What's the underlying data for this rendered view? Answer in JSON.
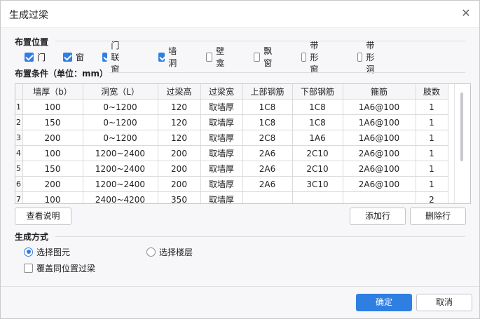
{
  "dialog": {
    "title": "生成过梁",
    "close_glyph": "✕"
  },
  "placement": {
    "label": "布置位置",
    "options": [
      {
        "label": "门",
        "checked": true
      },
      {
        "label": "窗",
        "checked": true
      },
      {
        "label": "门联窗",
        "checked": true
      },
      {
        "label": "墙洞",
        "checked": true
      },
      {
        "label": "壁龛",
        "checked": false
      },
      {
        "label": "飘窗",
        "checked": false
      },
      {
        "label": "带形窗",
        "checked": false
      },
      {
        "label": "带形洞",
        "checked": false
      }
    ]
  },
  "conditions": {
    "label": "布置条件（单位：mm）",
    "columns": [
      "",
      "墙厚（b）",
      "洞宽（L）",
      "过梁高",
      "过梁宽",
      "上部钢筋",
      "下部钢筋",
      "箍筋",
      "肢数"
    ],
    "rows": [
      [
        "1",
        "100",
        "0~1200",
        "120",
        "取墙厚",
        "1C8",
        "1C8",
        "1A6@100",
        "1"
      ],
      [
        "2",
        "150",
        "0~1200",
        "120",
        "取墙厚",
        "1C8",
        "1C8",
        "1A6@100",
        "1"
      ],
      [
        "3",
        "200",
        "0~1200",
        "120",
        "取墙厚",
        "2C8",
        "1A6",
        "1A6@100",
        "1"
      ],
      [
        "4",
        "100",
        "1200~2400",
        "200",
        "取墙厚",
        "2A6",
        "2C10",
        "2A6@100",
        "1"
      ],
      [
        "5",
        "150",
        "1200~2400",
        "200",
        "取墙厚",
        "2A6",
        "2C10",
        "2A6@100",
        "1"
      ],
      [
        "6",
        "200",
        "1200~2400",
        "200",
        "取墙厚",
        "2A6",
        "3C10",
        "2A6@100",
        "1"
      ],
      [
        "7",
        "100",
        "2400~4200",
        "350",
        "取墙厚",
        "",
        "",
        "",
        "2"
      ]
    ]
  },
  "buttons": {
    "view_help": "查看说明",
    "add_row": "添加行",
    "delete_row": "删除行",
    "ok": "确定",
    "cancel": "取消"
  },
  "generation": {
    "label": "生成方式",
    "radio_select_element": "选择图元",
    "radio_select_floor": "选择楼层",
    "selected": "选择图元",
    "overwrite_label": "覆盖同位置过梁",
    "overwrite_checked": false
  },
  "colors": {
    "accent": "#2f7fe3"
  }
}
